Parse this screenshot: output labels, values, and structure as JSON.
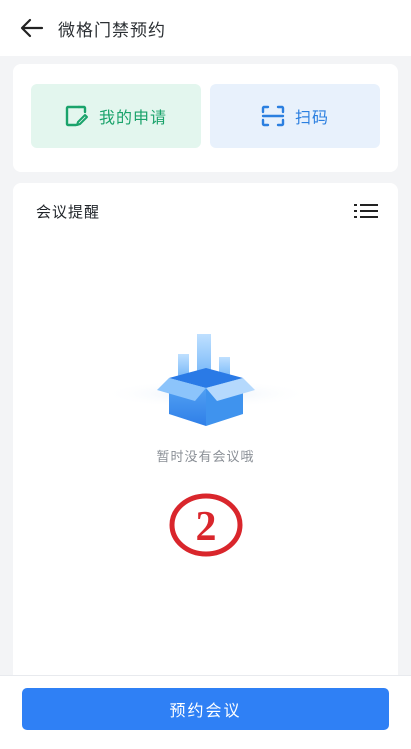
{
  "header": {
    "title": "微格门禁预约",
    "back_icon": "arrow-left-icon"
  },
  "actions": {
    "my_application": {
      "label": "我的申请",
      "icon": "edit-note-icon",
      "color": "#1aa36b"
    },
    "scan": {
      "label": "扫码",
      "icon": "scan-icon",
      "color": "#2b7fe0"
    }
  },
  "meeting": {
    "title": "会议提醒",
    "list_icon": "list-icon",
    "empty_text": "暂时没有会议哦",
    "badge": "②",
    "badge_color": "#d9262c"
  },
  "footer": {
    "book_label": "预约会议",
    "accent": "#2f80f5"
  }
}
